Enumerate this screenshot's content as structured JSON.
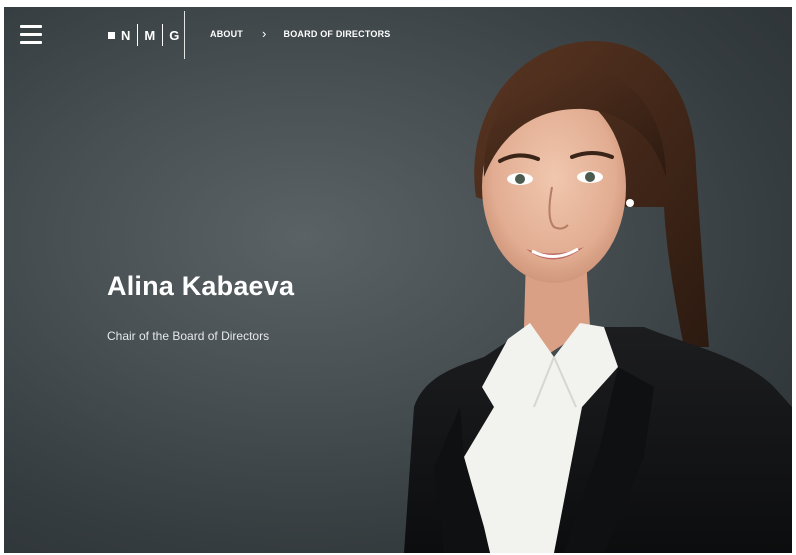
{
  "header": {
    "logo_letters": [
      "N",
      "M",
      "G"
    ],
    "breadcrumb": {
      "items": [
        "ABOUT",
        "BOARD OF DIRECTORS"
      ],
      "separator": "›"
    }
  },
  "hero": {
    "name": "Alina Kabaeva",
    "role": "Chair of the Board of Directors"
  },
  "colors": {
    "background": "#3f4649",
    "text": "#ffffff",
    "jacket": "#141516",
    "shirt": "#f4f4f2",
    "hair": "#4a2c1c",
    "skin": "#e8b9a0"
  },
  "icons": {
    "menu": "hamburger-menu-icon",
    "breadcrumb_separator": "chevron-right-icon"
  }
}
